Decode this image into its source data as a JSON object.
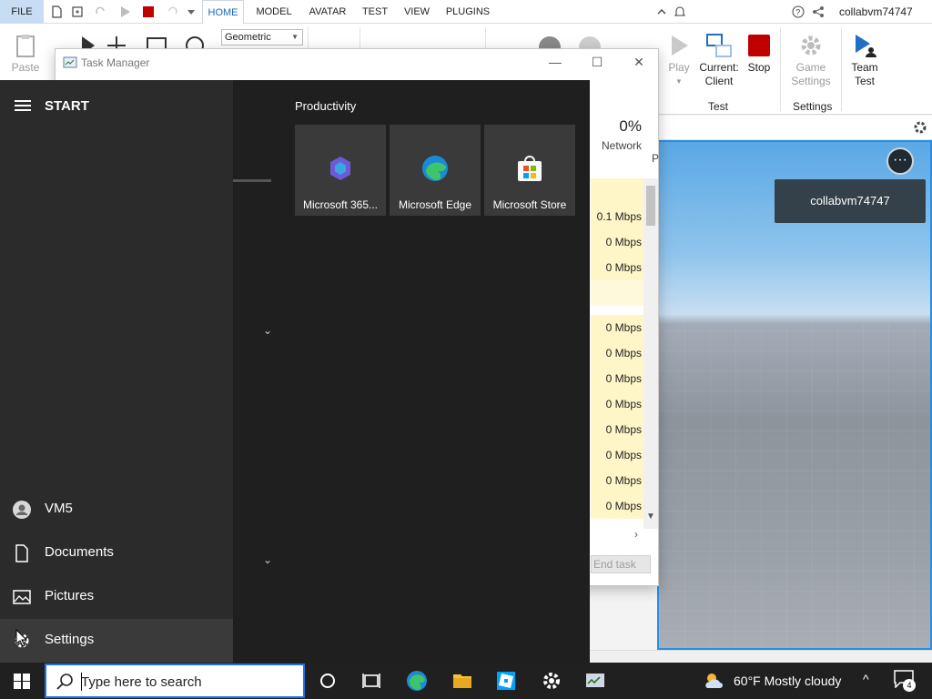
{
  "studio": {
    "file_tab": "FILE",
    "tabs": [
      {
        "label": "HOME",
        "active": true
      },
      {
        "label": "MODEL",
        "active": false
      },
      {
        "label": "AVATAR",
        "active": false
      },
      {
        "label": "TEST",
        "active": false
      },
      {
        "label": "VIEW",
        "active": false
      },
      {
        "label": "PLUGINS",
        "active": false
      }
    ],
    "username": "collabvm74747",
    "ribbon": {
      "paste_label": "Paste",
      "transform_mode": "Geometric",
      "play_label": "Play",
      "current_client_label_1": "Current:",
      "current_client_label_2": "Client",
      "stop_label": "Stop",
      "test_group": "Test",
      "game_settings_label_1": "Game",
      "game_settings_label_2": "Settings",
      "settings_group": "Settings",
      "team_test_label_1": "Team",
      "team_test_label_2": "Test"
    },
    "viewport": {
      "player_name": "collabvm74747",
      "menu_icon": "ellipsis-icon"
    }
  },
  "task_manager": {
    "title": "Task Manager",
    "network_percent": "0%",
    "network_header": "Network",
    "partial_header": "P",
    "network_rows": [
      "0.1 Mbps",
      "0 Mbps",
      "0 Mbps",
      "",
      "0 Mbps",
      "0 Mbps",
      "0 Mbps",
      "0 Mbps",
      "0 Mbps",
      "0 Mbps",
      "0 Mbps",
      "0 Mbps"
    ],
    "end_task": "End task"
  },
  "start_menu": {
    "header": "START",
    "group_title": "Productivity",
    "tiles": [
      {
        "label": "Microsoft 365...",
        "icon": "microsoft-365-icon"
      },
      {
        "label": "Microsoft Edge",
        "icon": "edge-icon"
      },
      {
        "label": "Microsoft Store",
        "icon": "store-icon"
      }
    ],
    "rail": [
      {
        "label": "VM5",
        "icon": "user-icon"
      },
      {
        "label": "Documents",
        "icon": "document-icon"
      },
      {
        "label": "Pictures",
        "icon": "pictures-icon"
      },
      {
        "label": "Settings",
        "icon": "gear-icon"
      }
    ]
  },
  "taskbar": {
    "search_placeholder": "Type here to search",
    "weather": "60°F  Mostly cloudy",
    "notification_count": "4"
  },
  "colors": {
    "accent": "#1a73e8",
    "stop_red": "#c00000",
    "start_bg": "#1f1f1f",
    "taskbar_bg": "#202020"
  }
}
